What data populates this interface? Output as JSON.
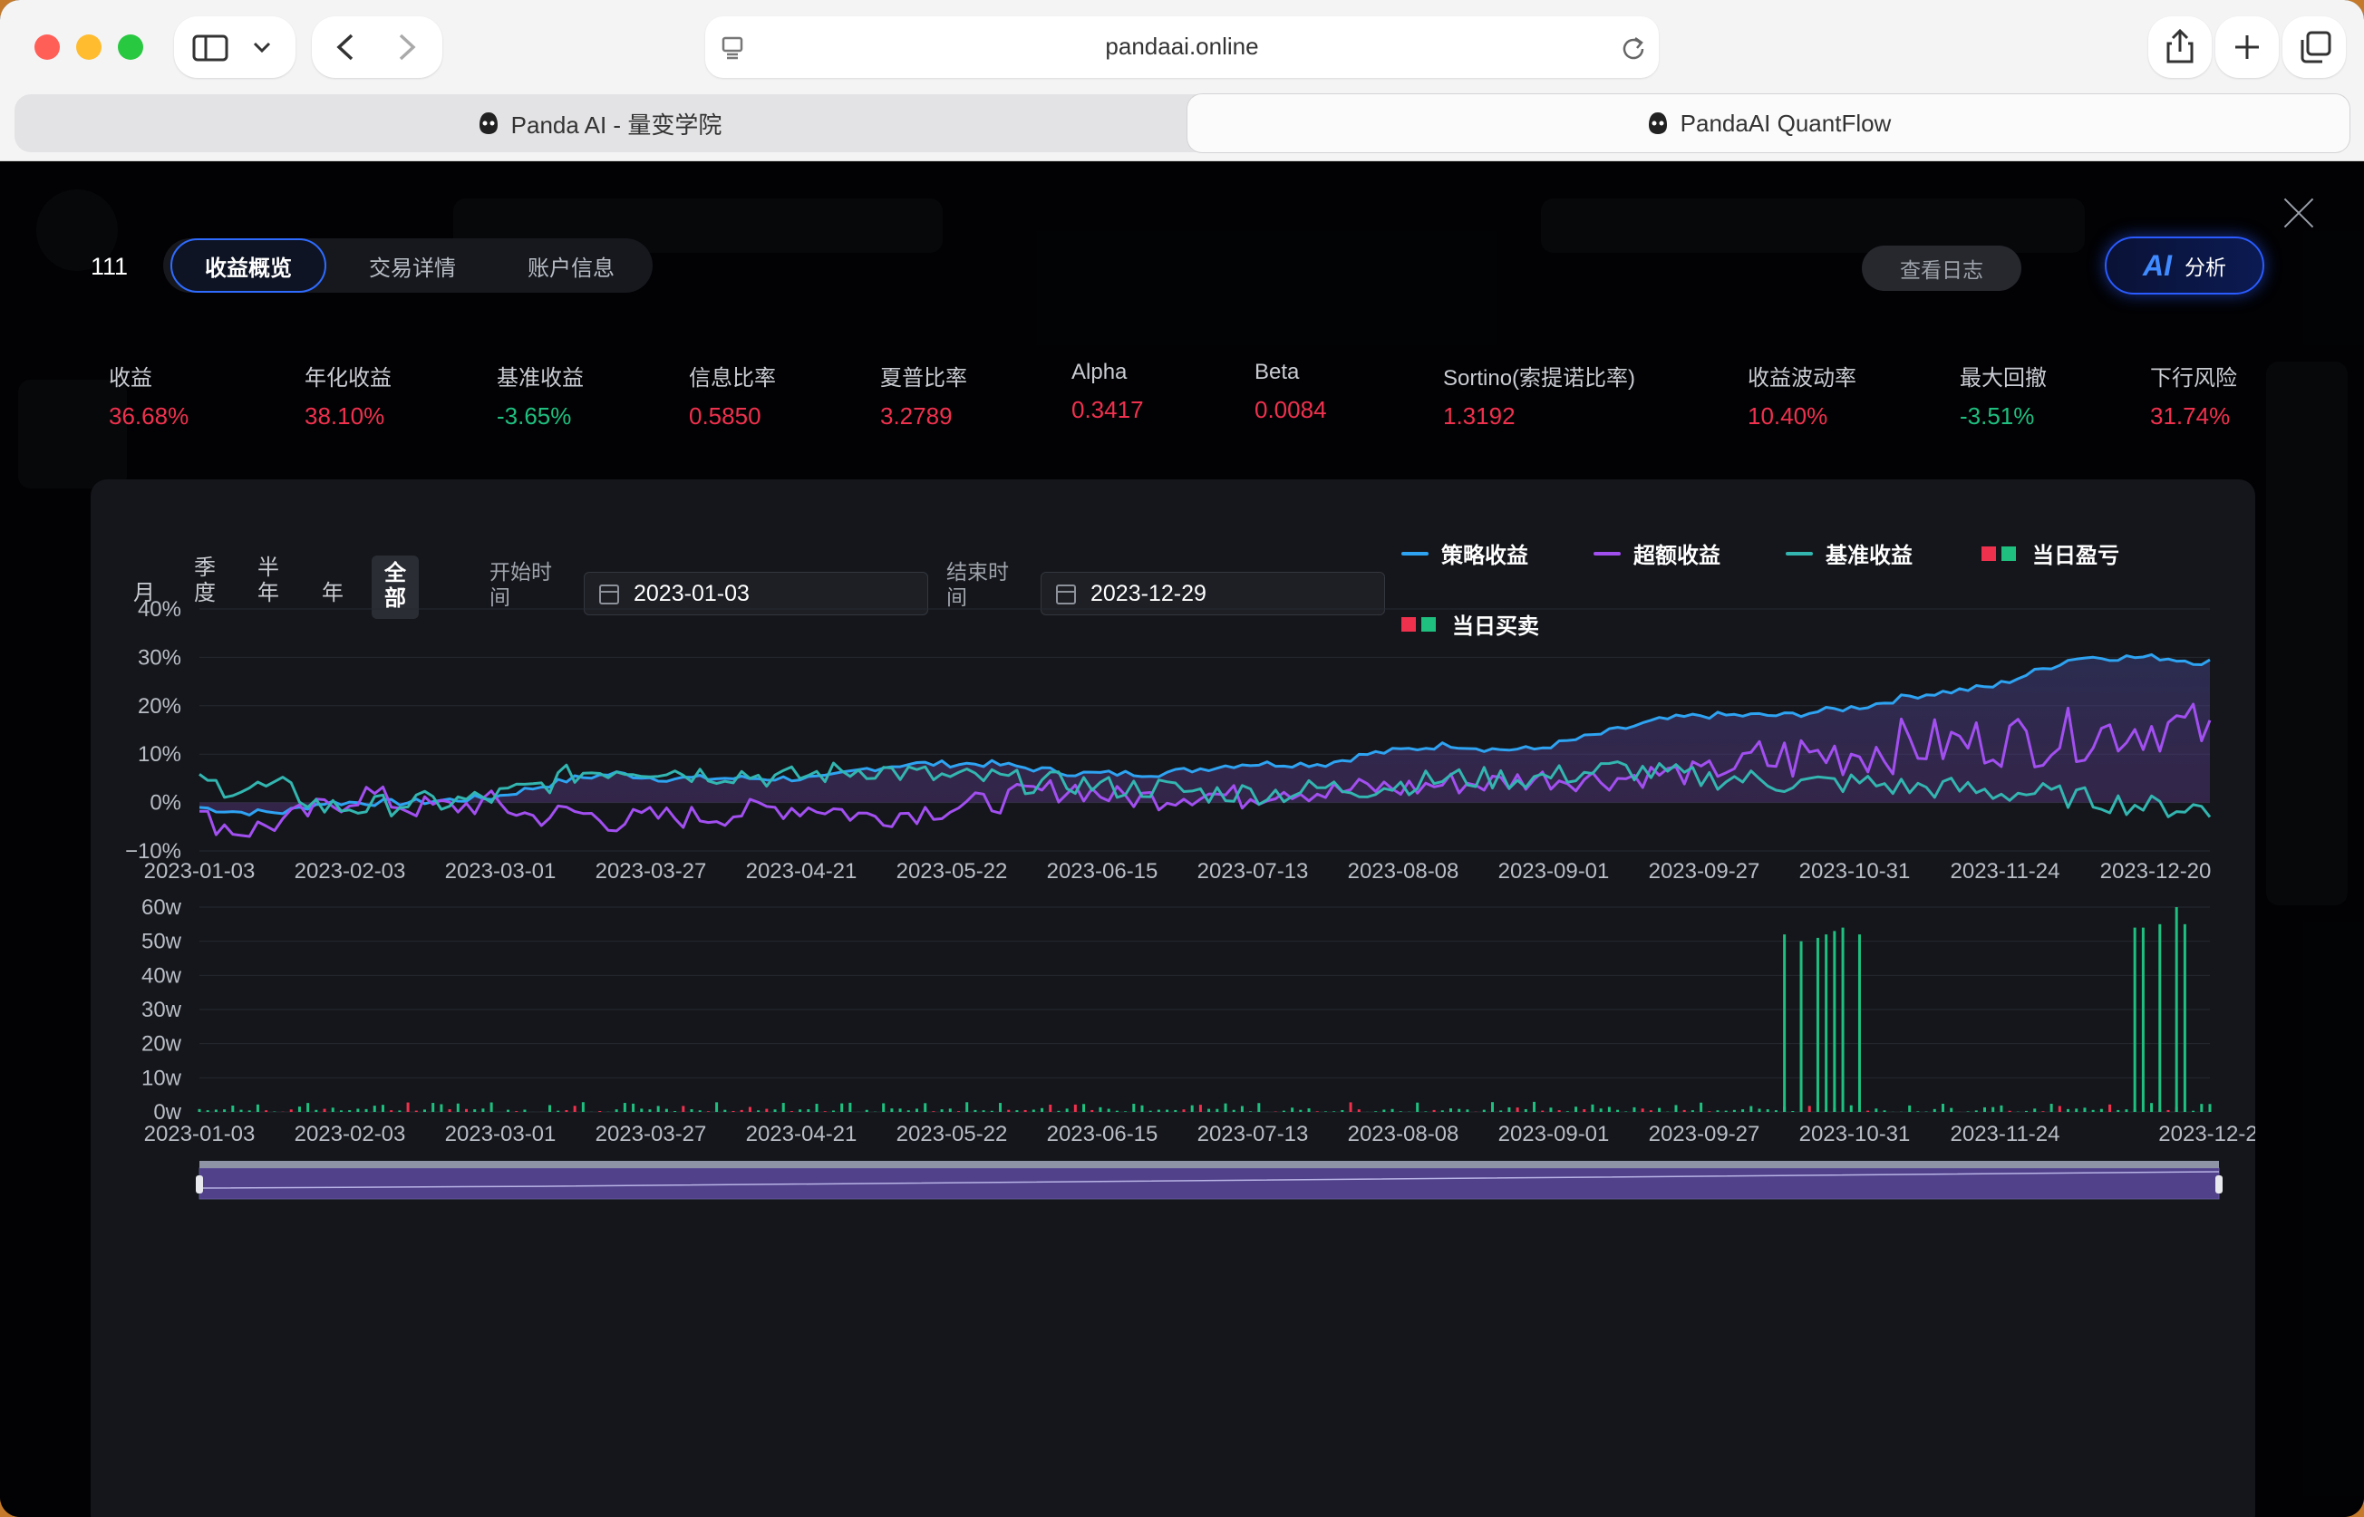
{
  "browser": {
    "url": "pandaai.online",
    "tabs": [
      {
        "label": "Panda AI - 量变学院",
        "active": false
      },
      {
        "label": "PandaAI QuantFlow",
        "active": true
      }
    ]
  },
  "header": {
    "account": "111",
    "tabs": [
      "收益概览",
      "交易详情",
      "账户信息"
    ],
    "active_tab": "收益概览",
    "log_button": "查看日志",
    "ai_button": {
      "badge": "AI",
      "label": "分析"
    }
  },
  "metrics": [
    {
      "label": "收益",
      "value": "36.68%",
      "color": "red"
    },
    {
      "label": "年化收益",
      "value": "38.10%",
      "color": "red"
    },
    {
      "label": "基准收益",
      "value": "-3.65%",
      "color": "green"
    },
    {
      "label": "信息比率",
      "value": "0.5850",
      "color": "red"
    },
    {
      "label": "夏普比率",
      "value": "3.2789",
      "color": "red"
    },
    {
      "label": "Alpha",
      "value": "0.3417",
      "color": "red"
    },
    {
      "label": "Beta",
      "value": "0.0084",
      "color": "red"
    },
    {
      "label": "Sortino(索提诺比率)",
      "value": "1.3192",
      "color": "red"
    },
    {
      "label": "收益波动率",
      "value": "10.40%",
      "color": "red"
    },
    {
      "label": "最大回撤",
      "value": "-3.51%",
      "color": "green"
    },
    {
      "label": "下行风险",
      "value": "31.74%",
      "color": "red"
    }
  ],
  "filters": {
    "periods": [
      "月",
      "季度",
      "半年",
      "年",
      "全部"
    ],
    "active_period": "全部",
    "start_label": "开始时间",
    "start_date": "2023-01-03",
    "end_label": "结束时间",
    "end_date": "2023-12-29"
  },
  "colors": {
    "strategy": "#2ea3f2",
    "excess": "#a24ff0",
    "benchmark": "#33b5b0",
    "up": "#f0314e",
    "down": "#1fbf7f"
  },
  "chart_data": [
    {
      "type": "line",
      "legend": [
        "策略收益",
        "超额收益",
        "基准收益",
        "当日盈亏",
        "当日买卖"
      ],
      "y_ticks": [
        "40%",
        "30%",
        "20%",
        "10%",
        "0%",
        "-10%"
      ],
      "ylim": [
        -10,
        40
      ],
      "x_ticks": [
        "2023-01-03",
        "2023-02-03",
        "2023-03-01",
        "2023-03-27",
        "2023-04-21",
        "2023-05-22",
        "2023-06-15",
        "2023-07-13",
        "2023-08-08",
        "2023-09-01",
        "2023-09-27",
        "2023-10-31",
        "2023-11-24",
        "2023-12-20"
      ],
      "grid": true,
      "series": [
        {
          "name": "策略收益",
          "x": [
            0,
            5,
            10,
            15,
            20,
            25,
            30,
            35,
            40,
            45,
            50,
            55,
            60,
            65,
            70,
            75,
            80,
            85,
            90,
            95,
            100,
            105,
            110,
            115,
            120,
            125,
            130,
            135,
            140,
            145,
            150,
            155,
            160,
            165,
            170,
            175,
            180,
            185,
            190,
            195,
            200,
            205,
            210,
            215,
            220,
            225,
            230,
            235,
            240,
            241
          ],
          "values": [
            -1,
            -2,
            -2,
            0,
            0,
            0,
            0.5,
            1,
            3,
            5,
            6,
            5,
            5,
            5,
            5,
            5,
            7,
            8,
            8,
            8,
            7,
            6,
            6,
            6,
            7,
            8,
            8,
            8,
            10,
            11,
            12,
            11,
            11,
            13,
            15,
            17,
            18,
            18,
            18,
            19,
            20,
            22,
            23,
            24,
            27,
            30,
            30,
            30,
            29,
            29.5
          ]
        },
        {
          "name": "超额收益",
          "x": [
            0,
            5,
            10,
            15,
            20,
            25,
            30,
            35,
            40,
            45,
            50,
            55,
            60,
            65,
            70,
            75,
            80,
            85,
            90,
            95,
            100,
            105,
            110,
            115,
            120,
            125,
            130,
            135,
            140,
            145,
            150,
            155,
            160,
            165,
            170,
            175,
            180,
            185,
            190,
            195,
            200,
            205,
            210,
            215,
            220,
            225,
            230,
            235,
            240,
            241
          ],
          "values": [
            -3,
            -6,
            -4,
            -1,
            2,
            -1,
            -1,
            0,
            -3,
            -2,
            -4,
            -3,
            -3,
            -2,
            -1,
            -1,
            -3,
            -2,
            -1,
            0,
            2,
            3,
            1,
            1,
            2,
            1,
            3,
            2,
            3,
            3,
            4,
            4,
            5,
            5,
            5,
            6,
            6,
            8,
            9,
            10,
            11,
            12,
            12,
            13,
            13,
            14,
            15,
            16,
            15,
            17
          ]
        },
        {
          "name": "基准收益",
          "x": [
            0,
            5,
            10,
            15,
            20,
            25,
            30,
            35,
            40,
            45,
            50,
            55,
            60,
            65,
            70,
            75,
            80,
            85,
            90,
            95,
            100,
            105,
            110,
            115,
            120,
            125,
            130,
            135,
            140,
            145,
            150,
            155,
            160,
            165,
            170,
            175,
            180,
            185,
            190,
            195,
            200,
            205,
            210,
            215,
            220,
            225,
            230,
            235,
            240,
            241
          ],
          "values": [
            4,
            3,
            3,
            -1,
            -1,
            0,
            0,
            1,
            3,
            6,
            7,
            7,
            6,
            6,
            5,
            6,
            7,
            6,
            5,
            5,
            4,
            4,
            3,
            3,
            2,
            2,
            2,
            3,
            3,
            4,
            5,
            5,
            5,
            6,
            7,
            6,
            5,
            5,
            4,
            4,
            4,
            3,
            3,
            2,
            2,
            1,
            0,
            -1,
            -1,
            -3
          ]
        }
      ]
    },
    {
      "type": "bar",
      "title": "当日买卖",
      "y_ticks": [
        "60w",
        "50w",
        "40w",
        "30w",
        "20w",
        "10w",
        "0w"
      ],
      "ylim": [
        0,
        60
      ],
      "x_ticks": [
        "2023-01-03",
        "2023-02-03",
        "2023-03-01",
        "2023-03-27",
        "2023-04-21",
        "2023-05-22",
        "2023-06-15",
        "2023-07-13",
        "2023-08-08",
        "2023-09-01",
        "2023-09-27",
        "2023-10-31",
        "2023-11-24",
        "2023-12-2"
      ],
      "spikes": [
        {
          "x": 190,
          "value": 52
        },
        {
          "x": 192,
          "value": 50
        },
        {
          "x": 194,
          "value": 51
        },
        {
          "x": 195,
          "value": 52
        },
        {
          "x": 196,
          "value": 53
        },
        {
          "x": 197,
          "value": 54
        },
        {
          "x": 199,
          "value": 52
        },
        {
          "x": 232,
          "value": 54
        },
        {
          "x": 233,
          "value": 54
        },
        {
          "x": 235,
          "value": 55
        },
        {
          "x": 237,
          "value": 60
        },
        {
          "x": 238,
          "value": 55
        }
      ]
    }
  ]
}
